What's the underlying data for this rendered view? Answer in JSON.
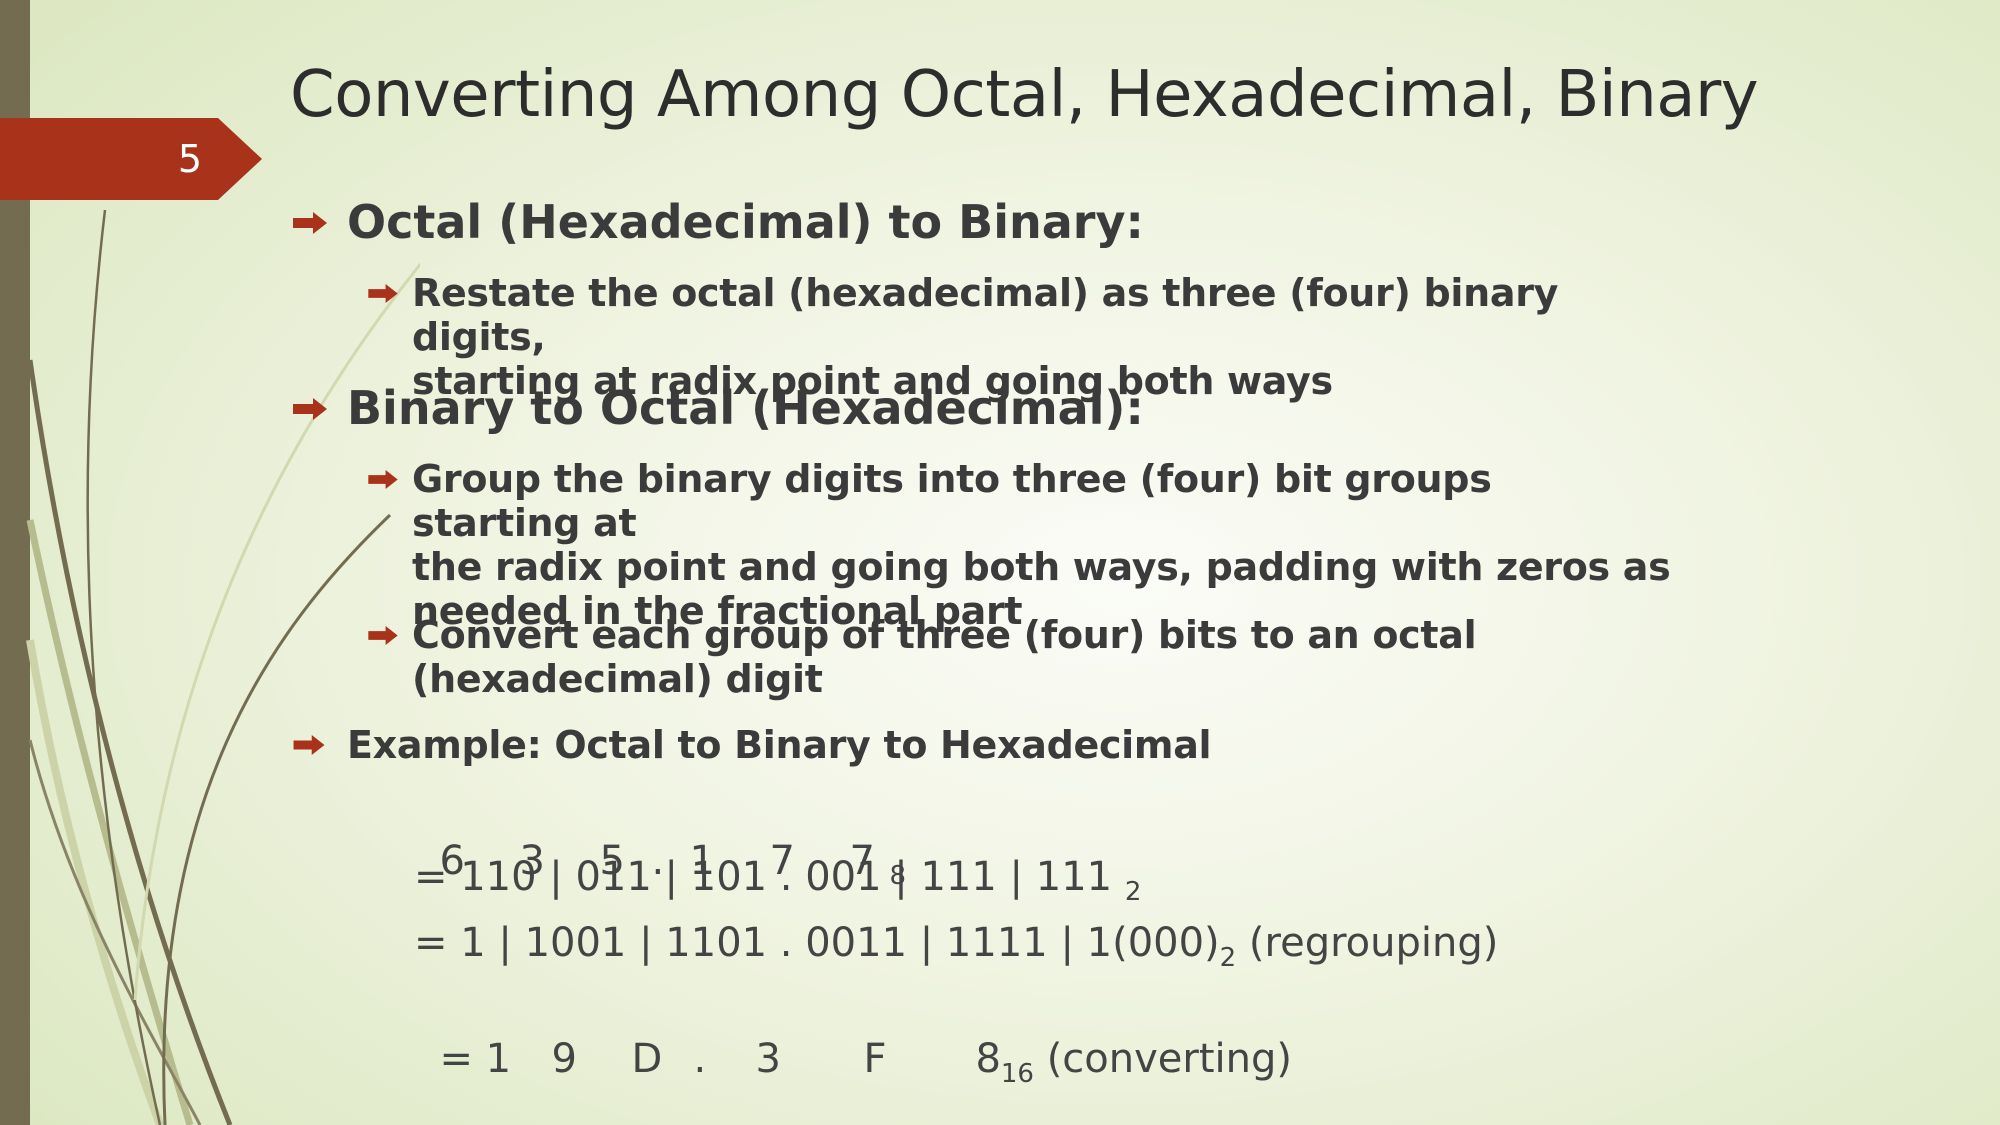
{
  "slide": {
    "number": "5",
    "title": "Converting Among Octal, Hexadecimal, Binary"
  },
  "bullets": {
    "b1": "Octal (Hexadecimal) to Binary:",
    "b1_sub1_line1": "Restate the octal (hexadecimal) as three (four) binary digits,",
    "b1_sub1_line2": "starting at radix point and going both ways",
    "b2": "Binary to Octal (Hexadecimal):",
    "b2_sub1_line1": "Group the binary digits into three (four) bit groups starting at",
    "b2_sub1_line2": "the radix point and going both ways, padding with zeros as",
    "b2_sub1_line3": "needed in the fractional part",
    "b2_sub2_line1": "Convert each group of three (four) bits to an octal",
    "b2_sub2_line2": "(hexadecimal) digit",
    "b3": "Example: Octal to Binary to Hexadecimal"
  },
  "example": {
    "octal_digits": [
      "6",
      "3",
      "5",
      ".",
      "1",
      "7",
      "7"
    ],
    "octal_base": "8",
    "binary_line": "= 110 | 011 | 101 . 001 | 111 | 111",
    "binary_base": "2",
    "regroup_line": "= 1 | 1001 | 1101 . 0011 | 1111 | 1(000)",
    "regroup_base": "2",
    "regroup_note": "(regrouping)",
    "hex_prefix": "= 1",
    "hex_digits": [
      "9",
      "D",
      ".",
      "3",
      "F",
      "8"
    ],
    "hex_base": "16",
    "hex_note": "(converting)"
  },
  "colors": {
    "accent": "#a8321a",
    "left_bar": "#736c50",
    "text": "#3b3b3b"
  },
  "icons": {
    "bullet": "right-arrow-icon",
    "decor": "grass-stems-decoration"
  }
}
